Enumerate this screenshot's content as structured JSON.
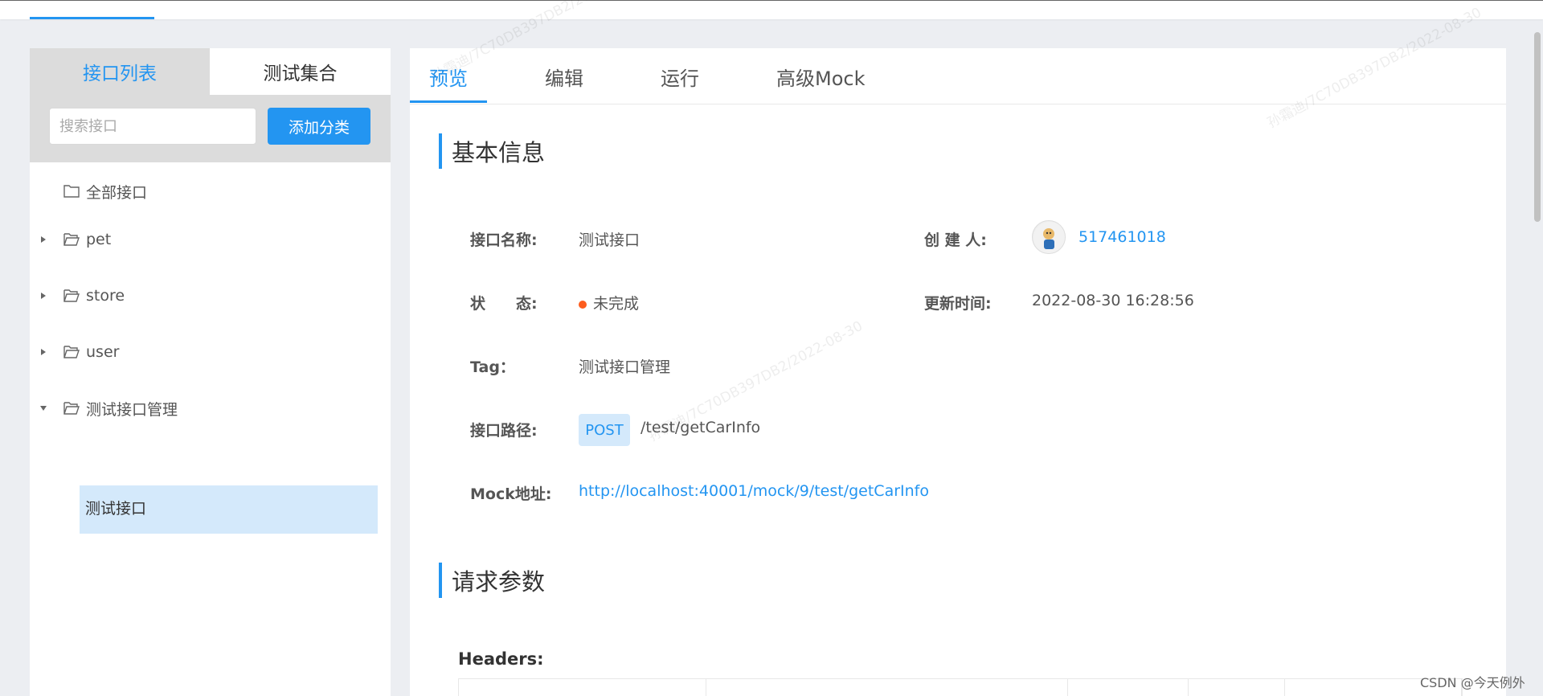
{
  "sidebar": {
    "tabs": [
      {
        "label": "接口列表"
      },
      {
        "label": "测试集合"
      }
    ],
    "search": {
      "placeholder": "搜索接口"
    },
    "add_category_label": "添加分类",
    "tree": [
      {
        "label": "全部接口"
      },
      {
        "label": "pet"
      },
      {
        "label": "store"
      },
      {
        "label": "user"
      },
      {
        "label": "测试接口管理"
      }
    ],
    "selected_leaf": "测试接口"
  },
  "main": {
    "tabs": [
      {
        "label": "预览"
      },
      {
        "label": "编辑"
      },
      {
        "label": "运行"
      },
      {
        "label": "高级Mock"
      }
    ],
    "basic_info": {
      "title": "基本信息",
      "name_label": "接口名称:",
      "name_value": "测试接口",
      "creator_label": "创 建 人:",
      "creator_value": "517461018",
      "status_label": "状　　态:",
      "status_value": "未完成",
      "status_color": "#fd5d1e",
      "updated_label": "更新时间:",
      "updated_value": "2022-08-30 16:28:56",
      "tag_label": "Tag：",
      "tag_value": "测试接口管理",
      "path_label": "接口路径:",
      "method": "POST",
      "path_value": "/test/getCarInfo",
      "mock_label": "Mock地址:",
      "mock_value": "http://localhost:40001/mock/9/test/getCarInfo"
    },
    "request": {
      "title": "请求参数",
      "headers_label": "Headers:"
    }
  },
  "accent_color": "#2395f1",
  "footer_credit": "CSDN @今天例外",
  "watermark_text": "孙霜迪/7C70DB397DB2/2022-08-30"
}
